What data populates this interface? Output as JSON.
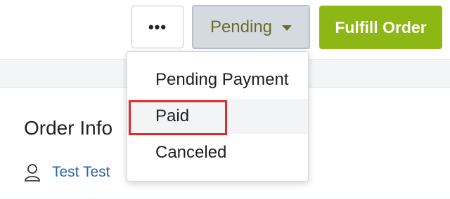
{
  "toolbar": {
    "more_label": "•••",
    "status_label": "Pending",
    "fulfill_label": "Fulfill Order"
  },
  "card": {
    "title": "Order Info",
    "customer_name": "Test Test"
  },
  "dropdown": {
    "items": [
      {
        "label": "Pending Payment"
      },
      {
        "label": "Paid"
      },
      {
        "label": "Canceled"
      }
    ]
  },
  "colors": {
    "accent_green": "#8cb714",
    "status_text": "#6b6b2a",
    "link_blue": "#2b62a8",
    "highlight_red": "#e02b2b"
  },
  "icons": {
    "more": "ellipsis-icon",
    "caret": "caret-down-icon",
    "customer": "person-icon"
  }
}
